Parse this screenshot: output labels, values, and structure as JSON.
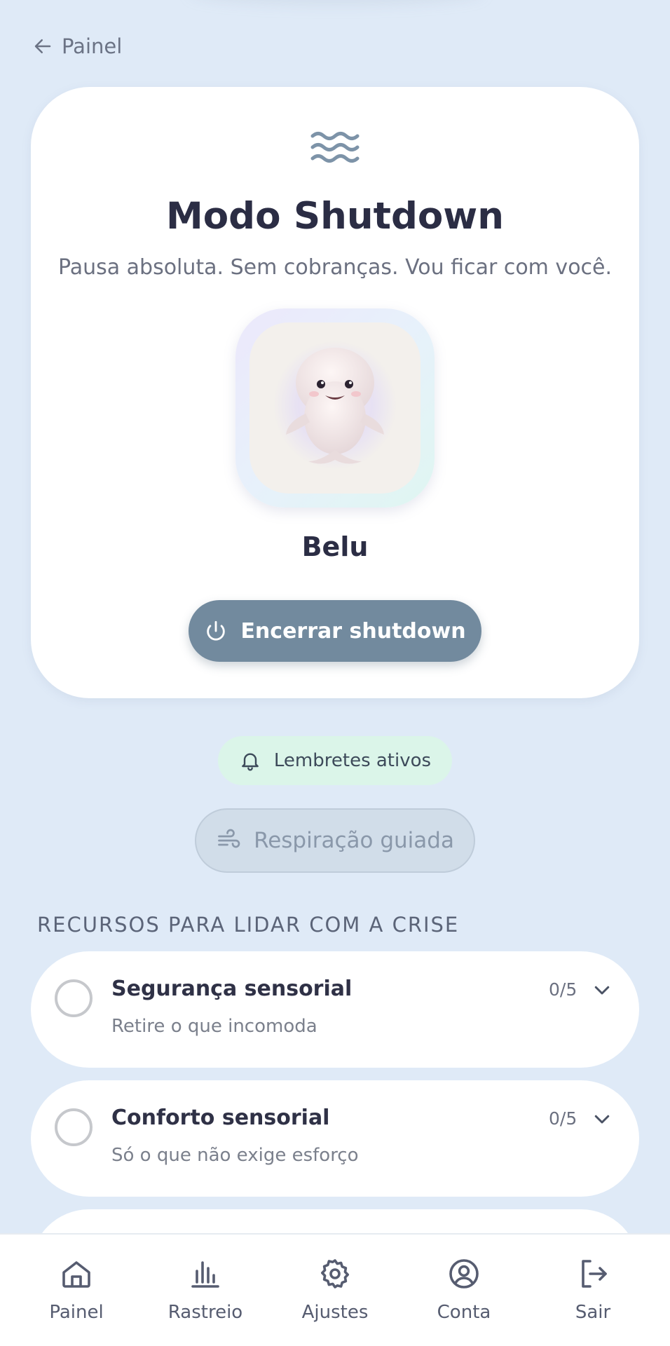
{
  "header": {
    "back_label": "Painel"
  },
  "hero": {
    "icon": "waves-icon",
    "title": "Modo Shutdown",
    "subtitle": "Pausa absoluta. Sem cobranças. Vou ficar com você.",
    "pet_name": "Belu",
    "end_button_label": "Encerrar shutdown"
  },
  "reminders": {
    "label": "Lembretes ativos",
    "icon": "bell-icon"
  },
  "breathing": {
    "label": "Respiração guiada",
    "icon": "wind-icon"
  },
  "resources": {
    "section_title": "RECURSOS PARA LIDAR COM A CRISE",
    "items": [
      {
        "title": "Segurança sensorial",
        "subtitle": "Retire o que incomoda",
        "count": "0/5"
      },
      {
        "title": "Conforto sensorial",
        "subtitle": "Só o que não exige esforço",
        "count": "0/5"
      }
    ]
  },
  "nav": {
    "items": [
      {
        "label": "Painel",
        "icon": "home-icon"
      },
      {
        "label": "Rastreio",
        "icon": "bar-chart-icon"
      },
      {
        "label": "Ajustes",
        "icon": "gear-icon"
      },
      {
        "label": "Conta",
        "icon": "user-circle-icon"
      },
      {
        "label": "Sair",
        "icon": "logout-icon"
      }
    ]
  },
  "colors": {
    "background": "#dfeaf7",
    "primary_button": "#728a9e",
    "reminder_pill": "#dbf5e9",
    "breath_button": "#d1dde9"
  }
}
